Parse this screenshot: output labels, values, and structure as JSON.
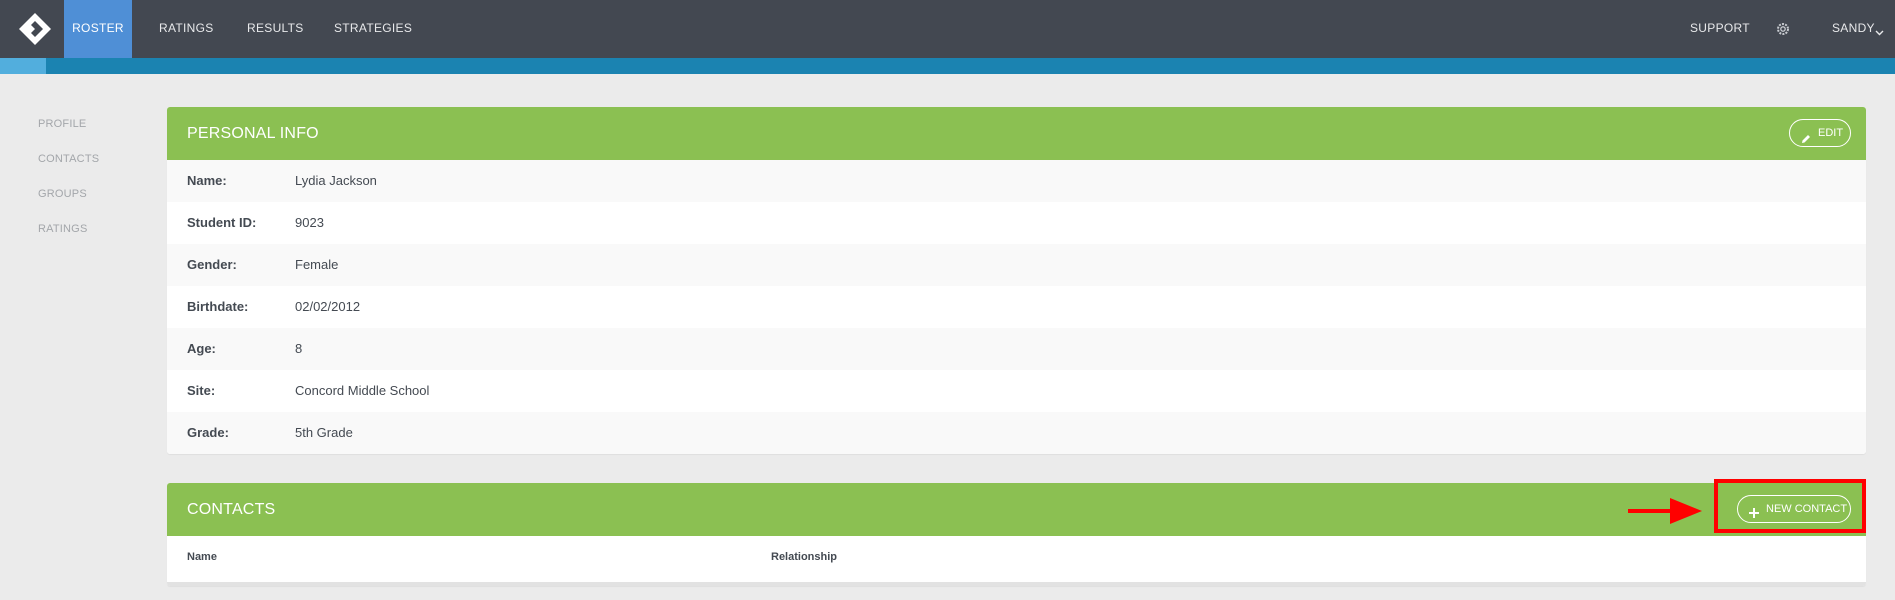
{
  "topbar": {
    "nav": [
      {
        "label": "ROSTER",
        "active": true
      },
      {
        "label": "RATINGS",
        "active": false
      },
      {
        "label": "RESULTS",
        "active": false
      },
      {
        "label": "STRATEGIES",
        "active": false
      }
    ],
    "support_label": "SUPPORT",
    "user_label": "SANDY",
    "icons": [
      "logo-icon",
      "gear-icon",
      "chevron-down-icon"
    ]
  },
  "sidebar": {
    "items": [
      {
        "label": "PROFILE"
      },
      {
        "label": "CONTACTS"
      },
      {
        "label": "GROUPS"
      },
      {
        "label": "RATINGS"
      }
    ]
  },
  "personal_info": {
    "title": "PERSONAL INFO",
    "edit_label": "EDIT",
    "fields": [
      {
        "key": "Name:",
        "value": "Lydia Jackson"
      },
      {
        "key": "Student ID:",
        "value": "9023"
      },
      {
        "key": "Gender:",
        "value": "Female"
      },
      {
        "key": "Birthdate:",
        "value": "02/02/2012"
      },
      {
        "key": "Age:",
        "value": "8"
      },
      {
        "key": "Site:",
        "value": "Concord Middle School"
      },
      {
        "key": "Grade:",
        "value": "5th Grade"
      }
    ]
  },
  "contacts": {
    "title": "CONTACTS",
    "new_contact_label": "NEW CONTACT",
    "columns": [
      "Name",
      "Relationship"
    ]
  },
  "colors": {
    "topbar": "#434851",
    "nav_active": "#4f8fd6",
    "panel_header": "#8bc052",
    "annotation": "#ff0000"
  }
}
